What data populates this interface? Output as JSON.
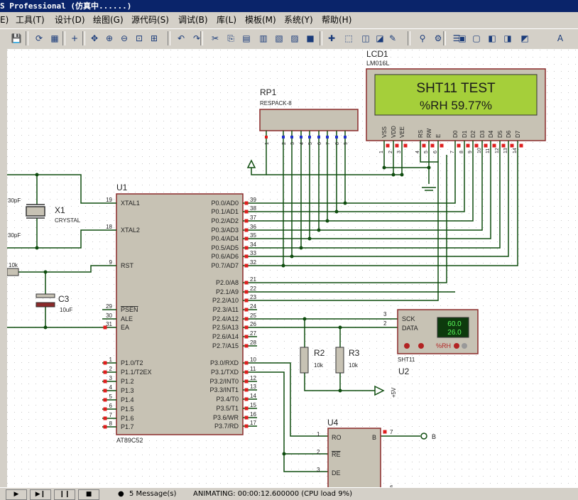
{
  "window": {
    "title": "S Professional (仿真中......)"
  },
  "menu": [
    "E)",
    "工具(T)",
    "设计(D)",
    "绘图(G)",
    "源代码(S)",
    "调试(B)",
    "库(L)",
    "模板(M)",
    "系统(Y)",
    "帮助(H)"
  ],
  "toolbar_icons": [
    "save-icon",
    "refresh-icon",
    "grid-icon",
    "origin-icon",
    "pan-icon",
    "zoom-in-icon",
    "zoom-out-icon",
    "zoom-area-icon",
    "zoom-all-icon",
    "undo-icon",
    "redo-icon",
    "cut-icon",
    "copy-icon",
    "paste-icon",
    "block-copy-icon",
    "block-move-icon",
    "block-rotate-icon",
    "block-delete-icon",
    "pick-device-icon",
    "make-device-icon",
    "packaging-icon",
    "decompose-icon",
    "wire-autoroute-icon",
    "search-icon",
    "property-assign-icon",
    "design-explorer-icon",
    "new-sheet-icon",
    "remove-sheet-icon",
    "bom-icon",
    "electrical-check-icon",
    "netlist-icon",
    "ares-icon"
  ],
  "components": {
    "lcd": {
      "ref": "LCD1",
      "part": "LM016L",
      "line1": "SHT11  TEST",
      "line2": "%RH    59.77%",
      "pin_names": [
        "VSS",
        "VDD",
        "VEE",
        "RS",
        "RW",
        "E",
        "D0",
        "D1",
        "D2",
        "D3",
        "D4",
        "D5",
        "D6",
        "D7"
      ],
      "pin_numbers": [
        "1",
        "2",
        "3",
        "4",
        "5",
        "6",
        "7",
        "8",
        "9",
        "10",
        "11",
        "12",
        "13",
        "14"
      ]
    },
    "rp1": {
      "ref": "RP1",
      "part": "RESPACK-8",
      "pin_numbers": [
        "1",
        "2",
        "3",
        "4",
        "5",
        "6",
        "7",
        "8",
        "9"
      ]
    },
    "u1": {
      "ref": "U1",
      "part": "AT89C52",
      "left_pins": [
        {
          "num": "19",
          "name": "XTAL1"
        },
        {
          "num": "18",
          "name": "XTAL2"
        },
        {
          "num": "9",
          "name": "RST"
        },
        {
          "num": "29",
          "name": "PSEN"
        },
        {
          "num": "30",
          "name": "ALE"
        },
        {
          "num": "31",
          "name": "EA"
        },
        {
          "num": "1",
          "name": "P1.0/T2"
        },
        {
          "num": "2",
          "name": "P1.1/T2EX"
        },
        {
          "num": "3",
          "name": "P1.2"
        },
        {
          "num": "4",
          "name": "P1.3"
        },
        {
          "num": "5",
          "name": "P1.4"
        },
        {
          "num": "6",
          "name": "P1.5"
        },
        {
          "num": "7",
          "name": "P1.6"
        },
        {
          "num": "8",
          "name": "P1.7"
        }
      ],
      "right_pins": [
        {
          "num": "39",
          "name": "P0.0/AD0"
        },
        {
          "num": "38",
          "name": "P0.1/AD1"
        },
        {
          "num": "37",
          "name": "P0.2/AD2"
        },
        {
          "num": "36",
          "name": "P0.3/AD3"
        },
        {
          "num": "35",
          "name": "P0.4/AD4"
        },
        {
          "num": "34",
          "name": "P0.5/AD5"
        },
        {
          "num": "33",
          "name": "P0.6/AD6"
        },
        {
          "num": "32",
          "name": "P0.7/AD7"
        },
        {
          "num": "21",
          "name": "P2.0/A8"
        },
        {
          "num": "22",
          "name": "P2.1/A9"
        },
        {
          "num": "23",
          "name": "P2.2/A10"
        },
        {
          "num": "24",
          "name": "P2.3/A11"
        },
        {
          "num": "25",
          "name": "P2.4/A12"
        },
        {
          "num": "26",
          "name": "P2.5/A13"
        },
        {
          "num": "27",
          "name": "P2.6/A14"
        },
        {
          "num": "28",
          "name": "P2.7/A15"
        },
        {
          "num": "10",
          "name": "P3.0/RXD"
        },
        {
          "num": "11",
          "name": "P3.1/TXD"
        },
        {
          "num": "12",
          "name": "P3.2/INT0"
        },
        {
          "num": "13",
          "name": "P3.3/INT1"
        },
        {
          "num": "14",
          "name": "P3.4/T0"
        },
        {
          "num": "15",
          "name": "P3.5/T1"
        },
        {
          "num": "16",
          "name": "P3.6/WR"
        },
        {
          "num": "17",
          "name": "P3.7/RD"
        }
      ]
    },
    "x1": {
      "ref": "X1",
      "part": "CRYSTAL",
      "cap_top": "30pF",
      "cap_bottom": "30pF"
    },
    "c3": {
      "ref": "C3",
      "value": "10uF"
    },
    "r_rst": {
      "value": "10k"
    },
    "sht11": {
      "ref": "U2",
      "part": "SHT11",
      "pin_sck": "SCK",
      "pin_data": "DATA",
      "sck_num": "3",
      "data_num": "2",
      "readout_temp": "60.0",
      "readout_rh": "26.0",
      "mode": "%RH"
    },
    "r2": {
      "ref": "R2",
      "value": "10k"
    },
    "r3": {
      "ref": "R3",
      "value": "10k"
    },
    "vcc": {
      "label": "+5V"
    },
    "u4": {
      "ref": "U4",
      "pins_left": [
        {
          "num": "1",
          "name": "RO"
        },
        {
          "num": "2",
          "name": "RE"
        },
        {
          "num": "3",
          "name": "DE"
        }
      ],
      "pins_right": [
        {
          "num": "7",
          "name": "B"
        }
      ],
      "net_b": "B",
      "pin6_num": "6"
    }
  },
  "status": {
    "messages": "5 Message(s)",
    "animating": "ANIMATING: 00:00:12.600000 (CPU load 9%)"
  }
}
